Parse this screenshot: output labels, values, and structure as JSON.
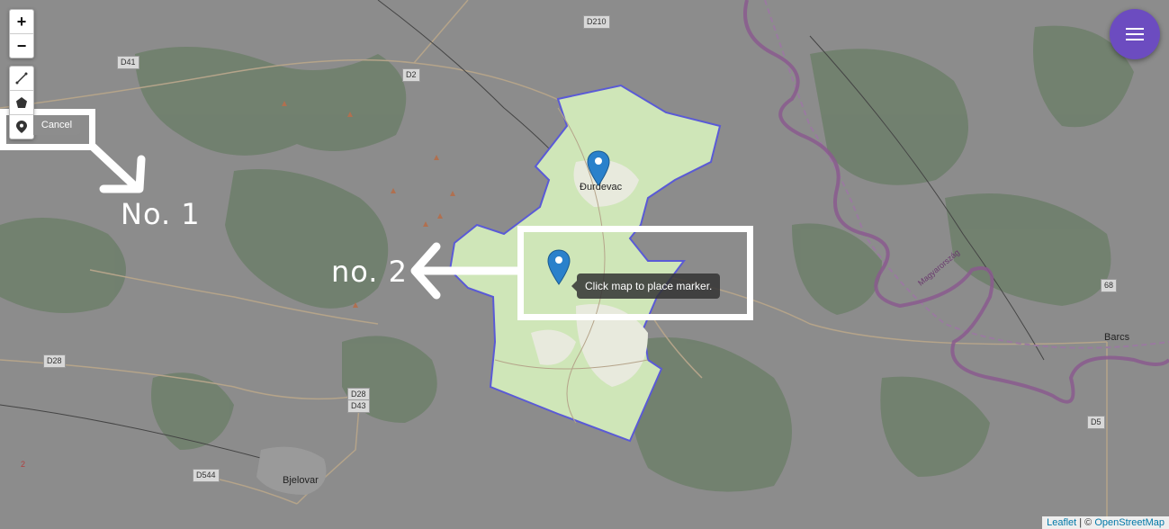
{
  "zoom": {
    "in_label": "+",
    "out_label": "−"
  },
  "draw": {
    "cancel_label": "Cancel",
    "tools": [
      "polyline-icon",
      "polygon-icon",
      "marker-icon"
    ]
  },
  "tooltip": {
    "text": "Click map to place marker."
  },
  "annotations": {
    "one": "No. 1",
    "two": "no. 2"
  },
  "places": {
    "durdevac": "Đurđevac",
    "bjelovar": "Bjelovar",
    "barcs": "Barcs",
    "river": "Magyarország"
  },
  "roads": {
    "d210": "D210",
    "d41": "D41",
    "d2": "D2",
    "d28a": "D28",
    "d28b": "D28",
    "d43": "D43",
    "d544": "D544",
    "d5": "D5",
    "r68": "68",
    "r2": "2"
  },
  "attribution": {
    "leaflet": "Leaflet",
    "sep": " | © ",
    "osm": "OpenStreetMap"
  },
  "colors": {
    "overlay": "#8a8a8a",
    "region_fill": "#cfe6b8",
    "region_stroke": "#5a5ad6",
    "marker": "#2a81cb",
    "menu_button": "#6c4cc0",
    "river": "#8a5a8e"
  }
}
